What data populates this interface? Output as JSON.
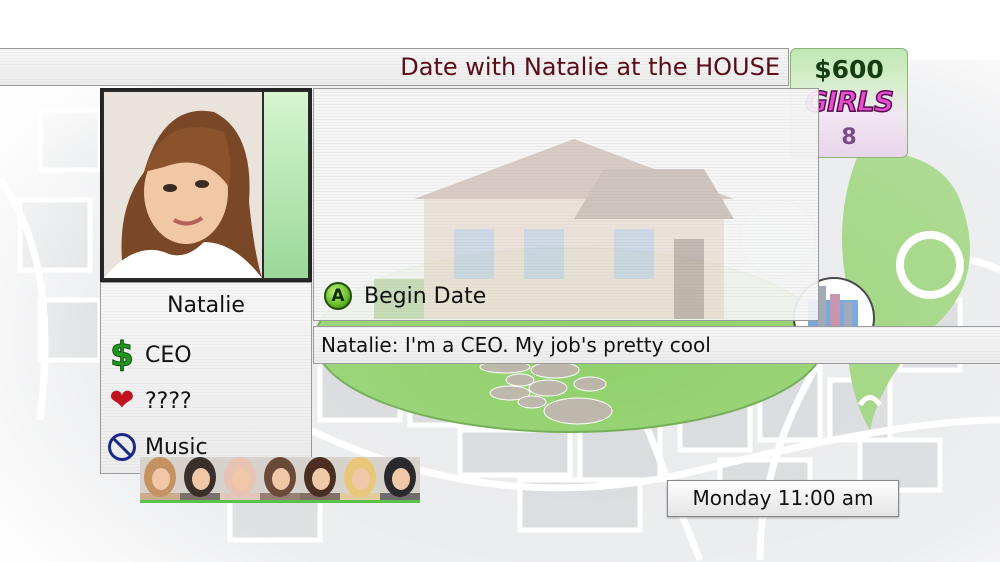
{
  "header": {
    "title": "Date with Natalie at the HOUSE"
  },
  "stats": {
    "money": "$600",
    "girls_label": "GIRLS",
    "girls_count": "8"
  },
  "profile": {
    "name": "Natalie",
    "job": "CEO",
    "likes": "????",
    "dislikes": "Music",
    "affection": 1.0
  },
  "scene": {
    "location": "HOUSE",
    "action_button": "A",
    "action_label": "Begin Date"
  },
  "dialogue": {
    "text": "Natalie: I'm a CEO.  My job's pretty cool"
  },
  "clock": {
    "text": "Monday 11:00 am"
  },
  "roster": {
    "count": 7,
    "colors": [
      "#c69262",
      "#3b2f2a",
      "#e8c2b2",
      "#6b4a3a",
      "#4a2e22",
      "#e8c878",
      "#2a2a2e"
    ]
  },
  "colors": {
    "title_text": "#5a0c18",
    "money_text": "#163d12",
    "girls_text": "#e84fd0",
    "affection_bar": "#9bd89a",
    "map_green": "#8fd06a",
    "action_green": "#6cc12a"
  },
  "icons": {
    "job": "dollar-icon",
    "likes": "heart-icon",
    "dislikes": "no-icon",
    "action": "a-button-icon"
  }
}
